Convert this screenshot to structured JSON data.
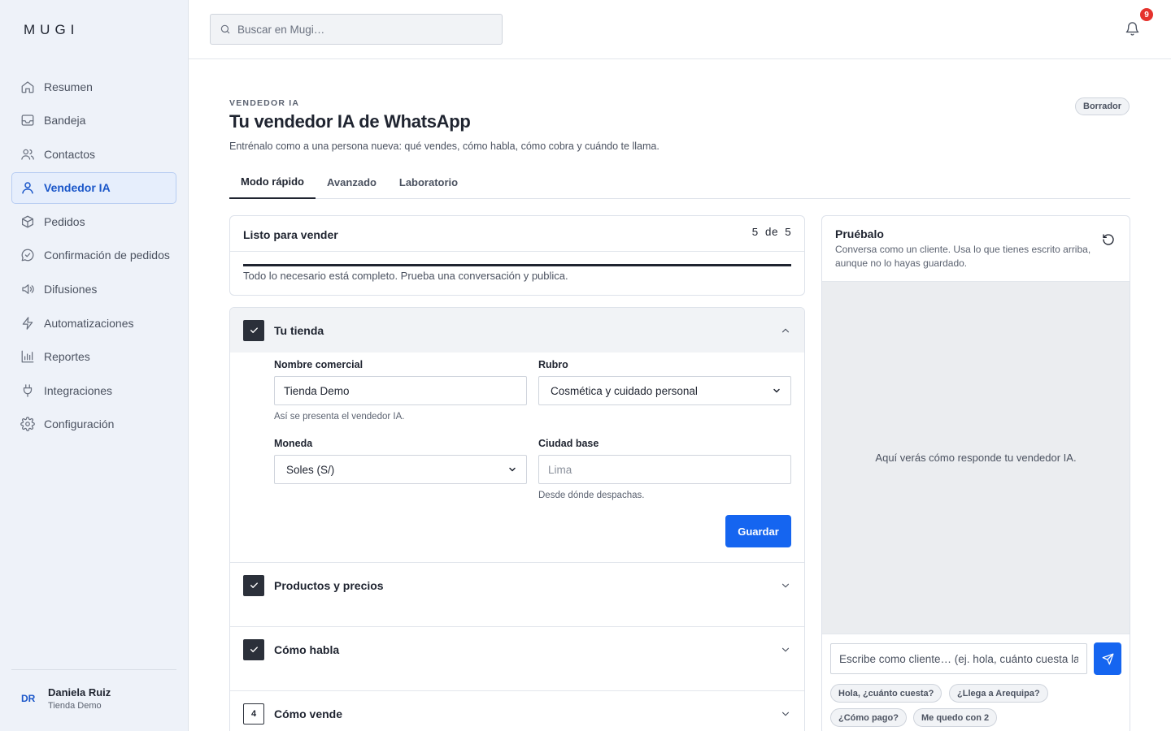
{
  "app": {
    "logo": "MUGI"
  },
  "sidebar": {
    "items": [
      {
        "label": "Resumen",
        "icon": "home-icon"
      },
      {
        "label": "Bandeja",
        "icon": "inbox-icon"
      },
      {
        "label": "Contactos",
        "icon": "users-icon"
      },
      {
        "label": "Vendedor IA",
        "icon": "user-icon",
        "active": true
      },
      {
        "label": "Pedidos",
        "icon": "package-icon"
      },
      {
        "label": "Confirmación de pedidos",
        "icon": "message-check-icon"
      },
      {
        "label": "Difusiones",
        "icon": "megaphone-icon"
      },
      {
        "label": "Automatizaciones",
        "icon": "lightning-icon"
      },
      {
        "label": "Reportes",
        "icon": "bar-chart-icon"
      },
      {
        "label": "Integraciones",
        "icon": "plug-icon"
      },
      {
        "label": "Configuración",
        "icon": "gear-icon"
      }
    ],
    "user": {
      "initials": "DR",
      "name": "Daniela Ruiz",
      "store": "Tienda Demo"
    }
  },
  "topbar": {
    "search_placeholder": "Buscar en Mugi…",
    "notification_count": "9"
  },
  "page": {
    "eyebrow": "VENDEDOR IA",
    "title": "Tu vendedor IA de WhatsApp",
    "subtitle": "Entrénalo como a una persona nueva: qué vendes, cómo habla, cómo cobra y cuándo te llama.",
    "status_badge": "Borrador",
    "tabs": [
      {
        "label": "Modo rápido",
        "active": true
      },
      {
        "label": "Avanzado"
      },
      {
        "label": "Laboratorio"
      }
    ]
  },
  "ready": {
    "title": "Listo para vender",
    "count": "5 de 5",
    "progress": 1.0,
    "message": "Todo lo necesario está completo. Prueba una conversación y publica."
  },
  "sections": [
    {
      "label": "Tu tienda",
      "done": true,
      "open": true,
      "fields": {
        "business_name": {
          "label": "Nombre comercial",
          "value": "Tienda Demo",
          "help": "Así se presenta el vendedor IA."
        },
        "category": {
          "label": "Rubro",
          "value": "Cosmética y cuidado personal"
        },
        "currency": {
          "label": "Moneda",
          "value": "Soles (S/)"
        },
        "city": {
          "label": "Ciudad base",
          "placeholder": "Lima",
          "help": "Desde dónde despachas."
        }
      },
      "save_label": "Guardar"
    },
    {
      "label": "Productos y precios",
      "done": true
    },
    {
      "label": "Cómo habla",
      "done": true
    },
    {
      "label": "Cómo vende",
      "done": false,
      "number": "4"
    }
  ],
  "tester": {
    "title": "Pruébalo",
    "subtitle": "Conversa como un cliente. Usa lo que tienes escrito arriba, aunque no lo hayas guardado.",
    "empty": "Aquí verás cómo responde tu vendedor IA.",
    "input_placeholder": "Escribe como cliente… (ej. hola, cuánto cuesta la",
    "chips": [
      "Hola, ¿cuánto cuesta?",
      "¿Llega a Arequipa?",
      "¿Cómo pago?",
      "Me quedo con 2"
    ]
  },
  "colors": {
    "accent": "#1565f0",
    "sidebar_bg": "#eef2f9",
    "active_nav": "#1a56c9",
    "badge": "#e5322d"
  }
}
